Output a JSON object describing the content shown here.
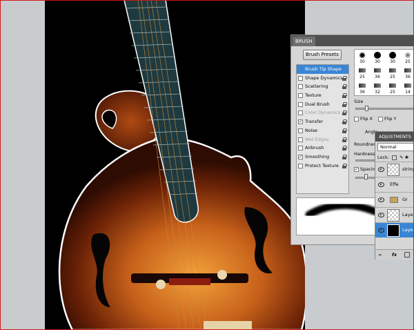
{
  "brush_panel": {
    "tab": "BRUSH",
    "presets_button": "Brush Presets",
    "settings": [
      {
        "label": "Brush Tip Shape",
        "checked": false,
        "selected": true,
        "lock": false,
        "disabled": false
      },
      {
        "label": "Shape Dynamics",
        "checked": false,
        "selected": false,
        "lock": true,
        "disabled": false
      },
      {
        "label": "Scattering",
        "checked": false,
        "selected": false,
        "lock": true,
        "disabled": false
      },
      {
        "label": "Texture",
        "checked": false,
        "selected": false,
        "lock": true,
        "disabled": false
      },
      {
        "label": "Dual Brush",
        "checked": false,
        "selected": false,
        "lock": true,
        "disabled": false
      },
      {
        "label": "Color Dynamics",
        "checked": false,
        "selected": false,
        "lock": true,
        "disabled": true
      },
      {
        "label": "Transfer",
        "checked": true,
        "selected": false,
        "lock": true,
        "disabled": false
      },
      {
        "label": "Noise",
        "checked": false,
        "selected": false,
        "lock": true,
        "disabled": false
      },
      {
        "label": "Wet Edges",
        "checked": false,
        "selected": false,
        "lock": true,
        "disabled": true
      },
      {
        "label": "Airbrush",
        "checked": false,
        "selected": false,
        "lock": true,
        "disabled": false
      },
      {
        "label": "Smoothing",
        "checked": true,
        "selected": false,
        "lock": true,
        "disabled": false
      },
      {
        "label": "Protect Texture",
        "checked": false,
        "selected": false,
        "lock": true,
        "disabled": false
      }
    ],
    "tips": [
      "30",
      "30",
      "30",
      "25",
      "25",
      "36",
      "25",
      "36",
      "36",
      "32",
      "25",
      "14"
    ],
    "size_label": "Size",
    "flip_x": "Flip X",
    "flip_y": "Flip Y",
    "angle_label": "Angle",
    "roundness_label": "Roundness",
    "hardness_label": "Hardness",
    "spacing_label": "Spacing"
  },
  "layers_panel": {
    "tab": "ADJUSTMENTS",
    "blend_mode": "Normal",
    "lock_label": "Lock:",
    "layers": [
      {
        "name": "string",
        "selected": false
      },
      {
        "name": "Effe",
        "selected": false
      },
      {
        "name": "Gr",
        "selected": false
      },
      {
        "name": "Laye",
        "selected": false
      },
      {
        "name": "Laye",
        "selected": true
      }
    ]
  }
}
